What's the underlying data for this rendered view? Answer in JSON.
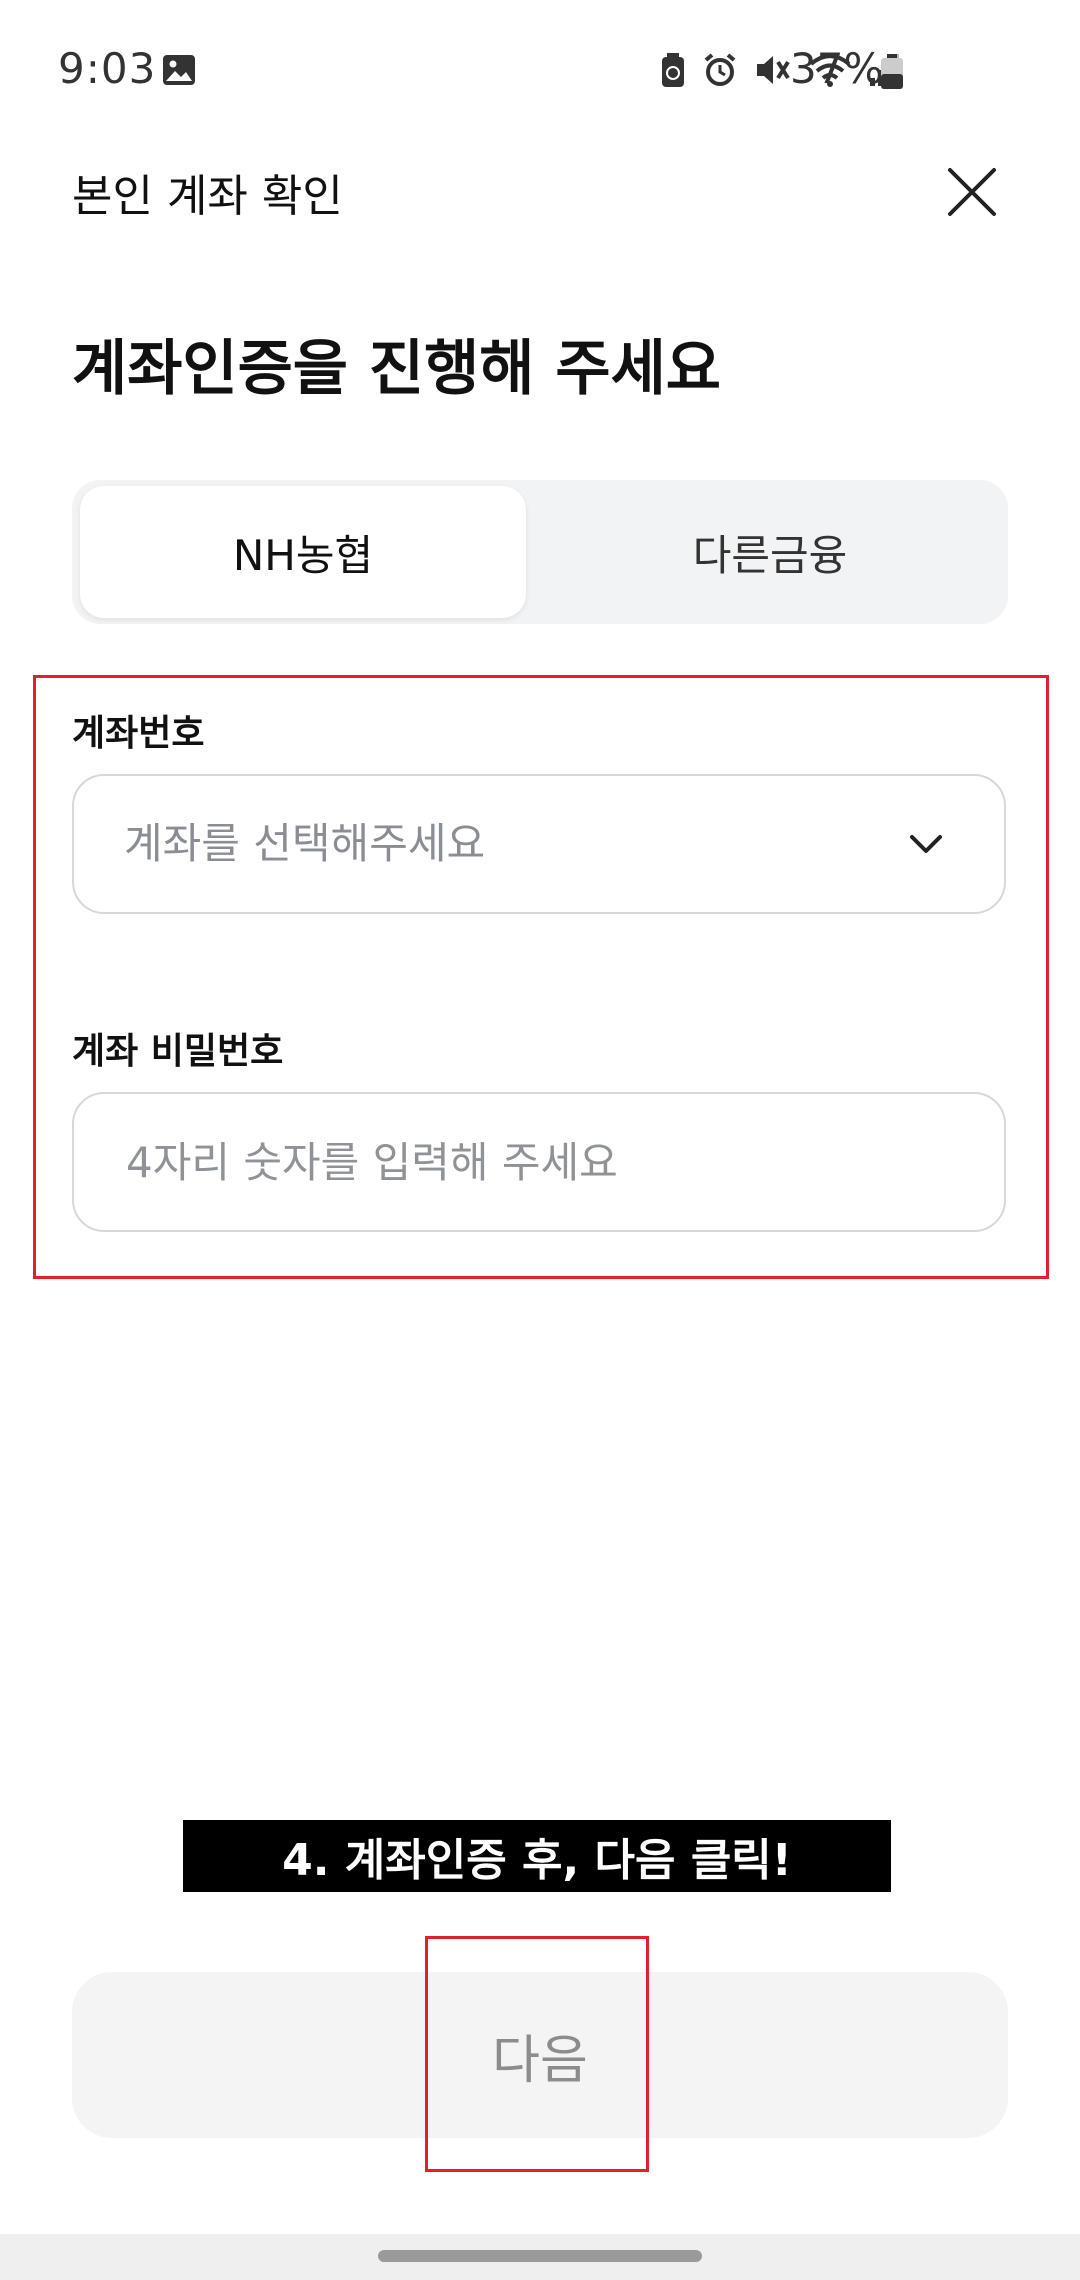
{
  "status_bar": {
    "time": "9:03",
    "battery_percent": "37%",
    "icons": [
      "gallery-icon",
      "battery-saver-icon",
      "alarm-icon",
      "mute-icon",
      "wifi-icon",
      "signal-icon",
      "battery-icon"
    ]
  },
  "header": {
    "title": "본인 계좌 확인",
    "close_icon": "close-icon"
  },
  "page_title": "계좌인증을 진행해 주세요",
  "tabs": [
    {
      "label": "NH농협",
      "active": true
    },
    {
      "label": "다른금융",
      "active": false
    }
  ],
  "account_number": {
    "label": "계좌번호",
    "placeholder": "계좌를 선택해주세요"
  },
  "account_password": {
    "label": "계좌 비밀번호",
    "placeholder": "4자리 숫자를 입력해 주세요"
  },
  "caption": "4. 계좌인증 후, 다음 클릭!",
  "next_button": {
    "label": "다음"
  },
  "colors": {
    "highlight": "#e0202c",
    "caption_bg": "#000000",
    "button_bg": "#f4f4f4",
    "segment_bg": "#f2f3f5"
  }
}
